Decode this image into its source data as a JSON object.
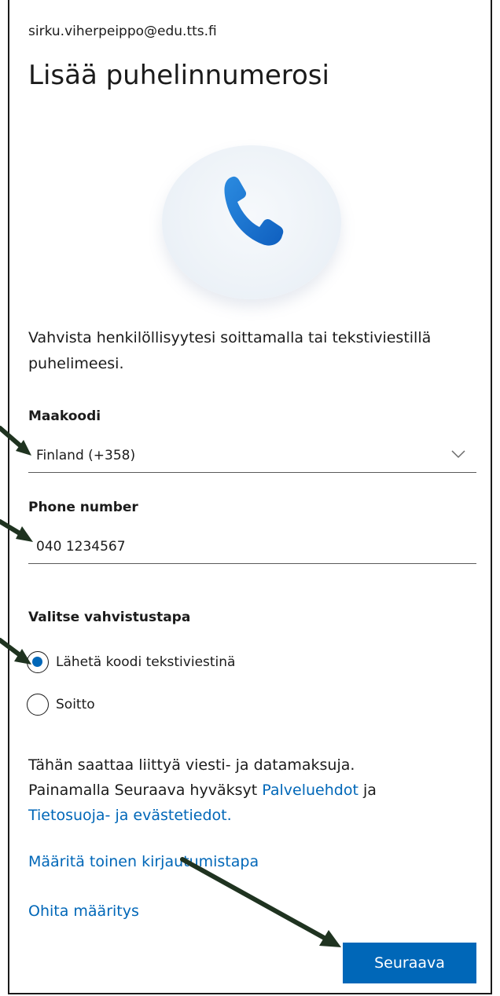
{
  "account": {
    "email": "sirku.viherpeippo@edu.tts.fi"
  },
  "heading": "Lisää puhelinnumerosi",
  "hero": {
    "icon": "phone-icon",
    "accent": "#1a7fd4"
  },
  "description": "Vahvista henkilöllisyytesi soittamalla tai tekstiviestillä puhelimeesi.",
  "country": {
    "label": "Maakoodi",
    "value": "Finland (+358)"
  },
  "phone": {
    "label": "Phone number",
    "value": "040 1234567"
  },
  "method": {
    "label": "Valitse vahvistustapa",
    "options": [
      {
        "label": "Lähetä koodi tekstiviestinä",
        "checked": true
      },
      {
        "label": "Soitto",
        "checked": false
      }
    ]
  },
  "legal": {
    "line1": "Tähän saattaa liittyä viesti- ja datamaksuja.",
    "line2_prefix": "Painamalla Seuraava hyväksyt",
    "terms_link": "Palveluehdot",
    "and": "ja",
    "privacy_link": "Tietosuoja- ja evästetiedot."
  },
  "links": {
    "other_method": "Määritä toinen kirjautumistapa",
    "skip": "Ohita määritys"
  },
  "next_button": "Seuraava",
  "colors": {
    "primary": "#0067b8",
    "annotation_arrow": "#1f3320"
  }
}
